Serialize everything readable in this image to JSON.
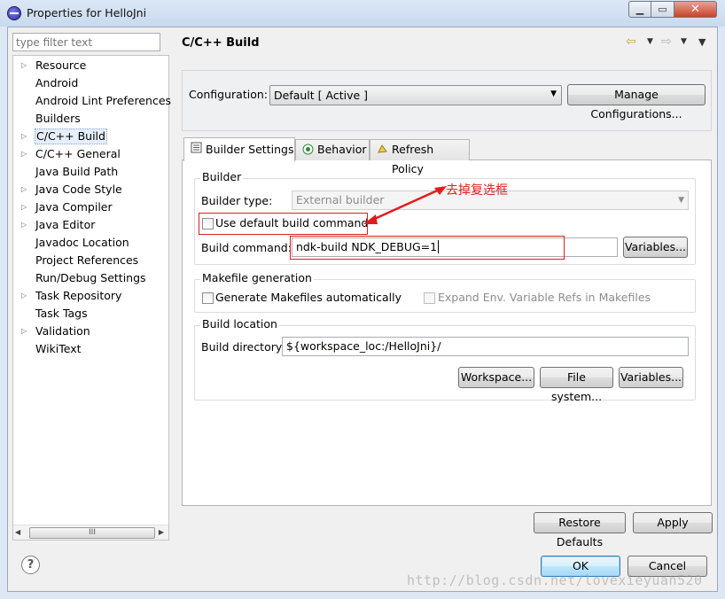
{
  "window": {
    "title": "Properties for HelloJni"
  },
  "filter": {
    "placeholder": "type filter text"
  },
  "tree": {
    "items": [
      {
        "label": "Resource",
        "expandable": true
      },
      {
        "label": "Android",
        "expandable": false
      },
      {
        "label": "Android Lint Preferences",
        "expandable": false
      },
      {
        "label": "Builders",
        "expandable": false
      },
      {
        "label": "C/C++ Build",
        "expandable": true,
        "selected": true
      },
      {
        "label": "C/C++ General",
        "expandable": true
      },
      {
        "label": "Java Build Path",
        "expandable": false
      },
      {
        "label": "Java Code Style",
        "expandable": true
      },
      {
        "label": "Java Compiler",
        "expandable": true
      },
      {
        "label": "Java Editor",
        "expandable": true
      },
      {
        "label": "Javadoc Location",
        "expandable": false
      },
      {
        "label": "Project References",
        "expandable": false
      },
      {
        "label": "Run/Debug Settings",
        "expandable": false
      },
      {
        "label": "Task Repository",
        "expandable": true
      },
      {
        "label": "Task Tags",
        "expandable": false
      },
      {
        "label": "Validation",
        "expandable": true
      },
      {
        "label": "WikiText",
        "expandable": false
      }
    ],
    "scroll_thumb_label": "III"
  },
  "page": {
    "title": "C/C++ Build"
  },
  "configuration": {
    "label": "Configuration:",
    "value": "Default  [ Active ]",
    "manage_button": "Manage Configurations..."
  },
  "tabs": [
    {
      "label": "Builder Settings",
      "active": true
    },
    {
      "label": "Behavior",
      "active": false
    },
    {
      "label": "Refresh Policy",
      "active": false
    }
  ],
  "builder": {
    "group_label": "Builder",
    "type_label": "Builder type:",
    "type_value": "External builder",
    "use_default_label": "Use default build command",
    "use_default_checked": false,
    "command_label": "Build command:",
    "command_value": "ndk-build NDK_DEBUG=1",
    "variables_button": "Variables..."
  },
  "makefile": {
    "group_label": "Makefile generation",
    "generate_label": "Generate Makefiles automatically",
    "generate_checked": false,
    "expand_label": "Expand Env. Variable Refs in Makefiles",
    "expand_checked": false
  },
  "location": {
    "group_label": "Build location",
    "dir_label": "Build directory:",
    "dir_value": "${workspace_loc:/HelloJni}/",
    "workspace_button": "Workspace...",
    "filesystem_button": "File system...",
    "variables_button": "Variables..."
  },
  "footer": {
    "restore_button": "Restore Defaults",
    "apply_button": "Apply",
    "ok_button": "OK",
    "cancel_button": "Cancel"
  },
  "annotation": {
    "text": "去掉复选框",
    "color": "#e01d1d"
  },
  "watermark": "http://blog.csdn.net/lovexieyuan520"
}
